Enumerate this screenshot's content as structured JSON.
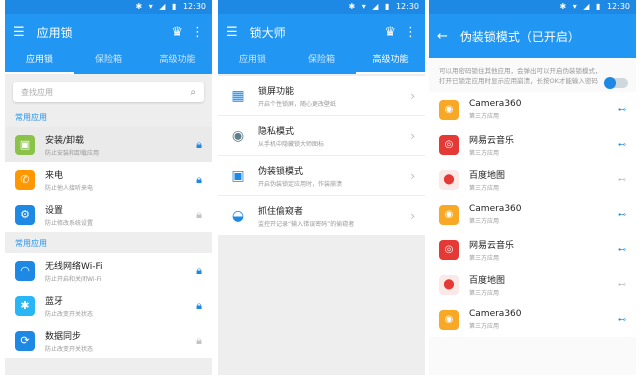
{
  "status": {
    "time": "12:30"
  },
  "panel1": {
    "title": "应用锁",
    "tabs": [
      {
        "label": "应用锁"
      },
      {
        "label": "保险箱"
      },
      {
        "label": "高级功能"
      }
    ],
    "search_placeholder": "查找应用",
    "sections": [
      {
        "title": "常用应用",
        "items": [
          {
            "name": "安装/卸载",
            "desc": "防止安装和卸载应用"
          },
          {
            "name": "来电",
            "desc": "防止他人接听来电"
          },
          {
            "name": "设置",
            "desc": "防止修改系统设置"
          }
        ]
      },
      {
        "title": "常用应用",
        "items": [
          {
            "name": "无线网络Wi-Fi",
            "desc": "防止开启和关闭Wi-Fi"
          },
          {
            "name": "蓝牙",
            "desc": "防止改变开关状态"
          },
          {
            "name": "数据同步",
            "desc": "防止改变开关状态"
          }
        ]
      }
    ]
  },
  "panel2": {
    "title": "锁大师",
    "tabs": [
      {
        "label": "应用锁"
      },
      {
        "label": "保险箱"
      },
      {
        "label": "高级功能"
      }
    ],
    "features": [
      {
        "name": "锁屏功能",
        "desc": "开启个性锁屏，随心更改壁纸"
      },
      {
        "name": "隐私模式",
        "desc": "从手机中隐藏锁大师图标"
      },
      {
        "name": "伪装锁模式",
        "desc": "开启伪装锁定应用时，作装崩溃"
      },
      {
        "name": "抓住偷窥者",
        "desc": "监控开记录“输入错误密码”的偷窥者"
      }
    ]
  },
  "panel3": {
    "title": "伪装锁模式（已开启）",
    "notice": "可以用密码锁住其他应用，会弹出可以开启伪装锁模式，打开已锁定应用时显示应用崩溃，长按OK才能输入密码",
    "apps": [
      {
        "name": "Camera360",
        "desc": "第三方应用"
      },
      {
        "name": "网易云音乐",
        "desc": "第三方应用"
      },
      {
        "name": "百度地图",
        "desc": "第三方应用"
      },
      {
        "name": "Camera360",
        "desc": "第三方应用"
      },
      {
        "name": "网易云音乐",
        "desc": "第三方应用"
      },
      {
        "name": "百度地图",
        "desc": "第三方应用"
      },
      {
        "name": "Camera360",
        "desc": "第三方应用"
      }
    ]
  }
}
